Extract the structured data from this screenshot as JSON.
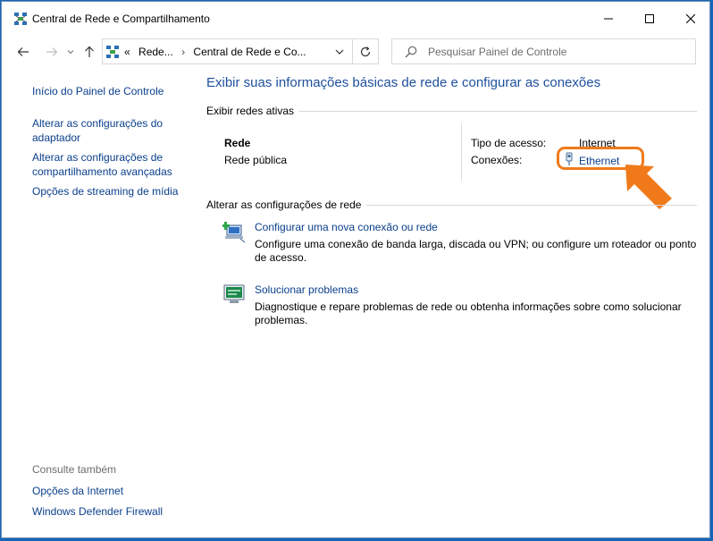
{
  "window": {
    "title": "Central de Rede e Compartilhamento"
  },
  "address_bar": {
    "crumb_prefix": "«",
    "crumbs": [
      "Rede...",
      "Central de Rede e Co..."
    ],
    "separator": "›"
  },
  "search": {
    "placeholder": "Pesquisar Painel de Controle"
  },
  "sidebar": {
    "links": [
      "Início do Painel de Controle",
      "Alterar as configurações do adaptador",
      "Alterar as configurações de compartilhamento avançadas",
      "Opções de streaming de mídia"
    ],
    "see_also_title": "Consulte também",
    "see_also_links": [
      "Opções da Internet",
      "Windows Defender Firewall"
    ]
  },
  "main": {
    "title": "Exibir suas informações básicas de rede e configurar as conexões",
    "active_networks_label": "Exibir redes ativas",
    "network": {
      "name": "Rede",
      "category": "Rede pública",
      "access_type_label": "Tipo de acesso:",
      "access_type_value": "Internet",
      "connections_label": "Conexões:",
      "connection_name": "Ethernet"
    },
    "change_settings_label": "Alterar as configurações de rede",
    "tasks": [
      {
        "title": "Configurar uma nova conexão ou rede",
        "description": "Configure uma conexão de banda larga, discada ou VPN; ou configure um roteador ou ponto de acesso."
      },
      {
        "title": "Solucionar problemas",
        "description": "Diagnostique e repare problemas de rede ou obtenha informações sobre como solucionar problemas."
      }
    ]
  },
  "colors": {
    "accent_highlight": "#f07a1a",
    "link": "#0a3f8b",
    "heading": "#1e4f9c",
    "desktop": "#1666b8"
  }
}
